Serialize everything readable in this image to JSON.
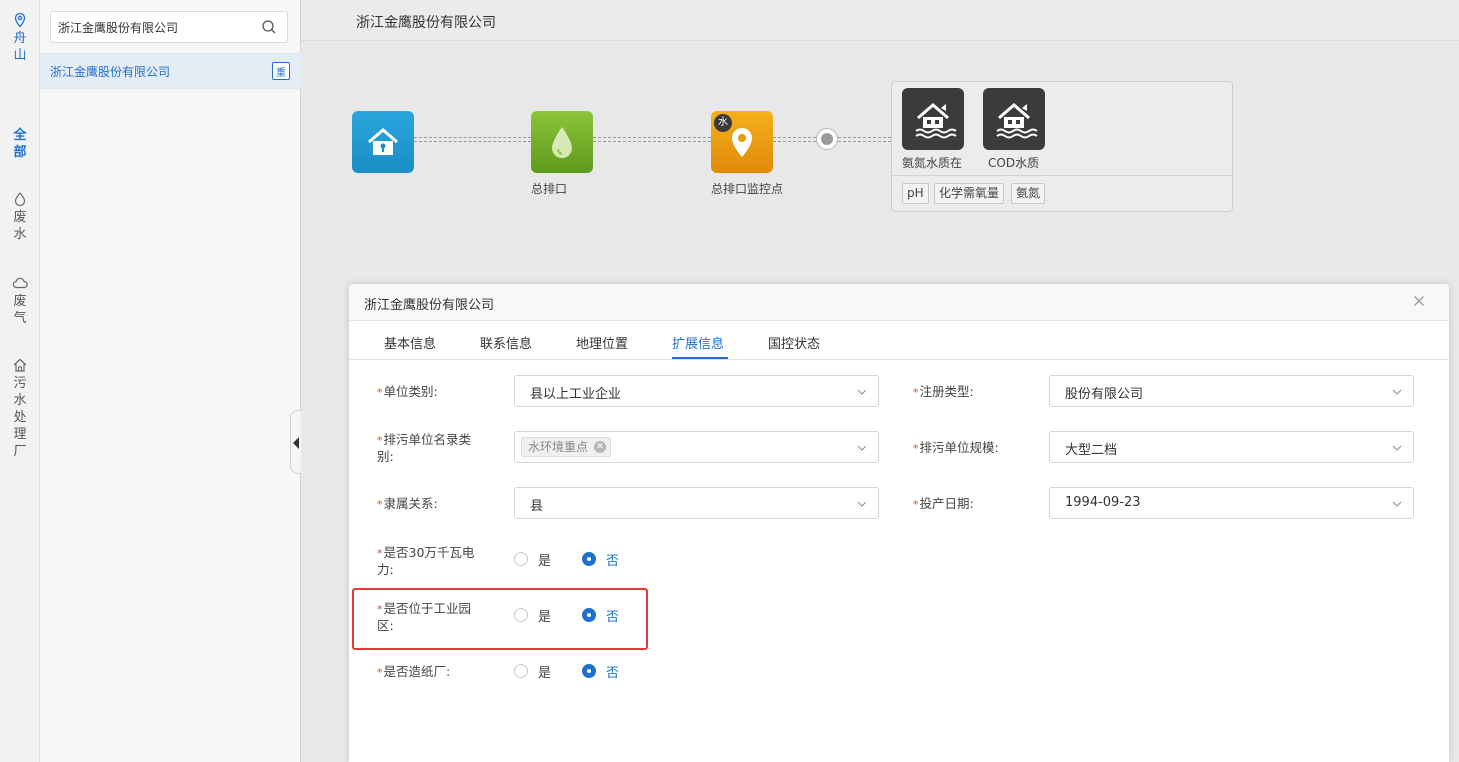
{
  "rail": {
    "items": [
      {
        "label": "舟山",
        "chars": [
          "舟",
          "山"
        ],
        "icon": "location-pin-icon",
        "active": false
      },
      {
        "label": "全部",
        "chars": [
          "全",
          "部"
        ],
        "icon": "",
        "active": true
      },
      {
        "label": "废水",
        "chars": [
          "废",
          "水"
        ],
        "icon": "water-drop-icon",
        "active": false
      },
      {
        "label": "废气",
        "chars": [
          "废",
          "气"
        ],
        "icon": "cloud-icon",
        "active": false
      },
      {
        "label": "污水处理厂",
        "chars": [
          "污",
          "水",
          "处",
          "理",
          "厂"
        ],
        "icon": "house-icon",
        "active": false
      }
    ]
  },
  "tree": {
    "search_value": "浙江金鹰股份有限公司",
    "selected_item": "浙江金鹰股份有限公司",
    "badge": "重"
  },
  "main": {
    "title": "浙江金鹰股份有限公司",
    "flow": {
      "node1_label": "",
      "node2_label": "总排口",
      "node3_label": "总排口监控点",
      "node3_badge": "水"
    },
    "stations": [
      {
        "label": "氨氮水质在"
      },
      {
        "label": "COD水质"
      }
    ],
    "tags": [
      "pH",
      "化学需氧量",
      "氨氮"
    ]
  },
  "modal": {
    "title": "浙江金鹰股份有限公司",
    "tabs": [
      "基本信息",
      "联系信息",
      "地理位置",
      "扩展信息",
      "国控状态"
    ],
    "active_tab": "扩展信息",
    "fields": {
      "unit_category": {
        "label": "单位类别:",
        "value": "县以上工业企业"
      },
      "reg_type": {
        "label": "注册类型:",
        "value": "股份有限公司"
      },
      "directory_category": {
        "label_line1": "排污单位名录类",
        "label_line2": "别:",
        "chip": "水环境重点"
      },
      "unit_scale": {
        "label": "排污单位规模:",
        "value": "大型二档"
      },
      "affiliation": {
        "label": "隶属关系:",
        "value": "县"
      },
      "start_date": {
        "label": "投产日期:",
        "value": "1994-09-23"
      },
      "power_300k": {
        "label_line1": "是否30万千瓦电",
        "label_line2": "力:",
        "yes": "是",
        "no": "否",
        "selected": "no"
      },
      "industrial_park": {
        "label_line1": "是否位于工业园",
        "label_line2": "区:",
        "yes": "是",
        "no": "否",
        "selected": "no"
      },
      "paper_mill": {
        "label": "是否造纸厂:",
        "yes": "是",
        "no": "否",
        "selected": "no"
      }
    }
  },
  "colors": {
    "accent": "#1f6fd1",
    "required": "#e04c3a",
    "highlight": "#e53935"
  }
}
